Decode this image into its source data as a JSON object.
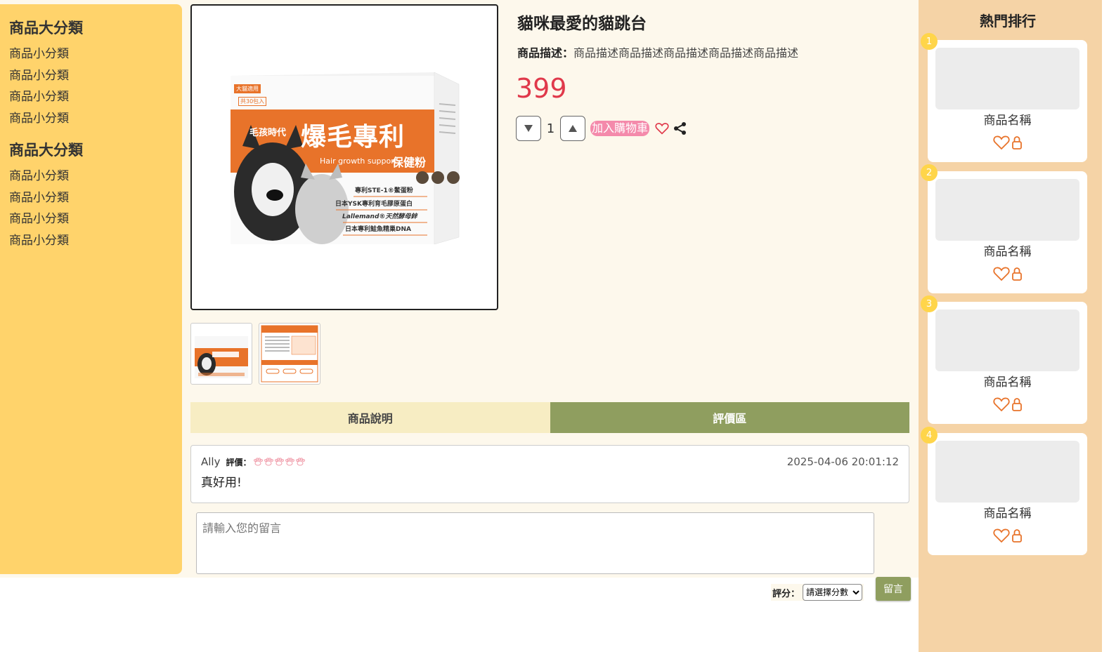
{
  "sidebar": {
    "groups": [
      {
        "title": "商品大分類",
        "items": [
          "商品小分類",
          "商品小分類",
          "商品小分類",
          "商品小分類"
        ]
      },
      {
        "title": "商品大分類",
        "items": [
          "商品小分類",
          "商品小分類",
          "商品小分類",
          "商品小分類"
        ]
      }
    ]
  },
  "product": {
    "title": "貓咪最愛的貓跳台",
    "desc_label": "商品描述：",
    "desc_text": "商品描述商品描述商品描述商品描述商品描述",
    "price": "399",
    "qty": "1",
    "add_to_cart": "加入購物車",
    "box_texts": {
      "badge1": "大貓適用",
      "badge2": "共30包入",
      "brand": "毛孩時代",
      "name": "爆毛專利",
      "sub_en": "Hair growth support",
      "sub_zh": "保健粉",
      "feature1": "專利STE-1®鱉蛋粉",
      "feature2": "日本YSK專利育毛膠原蛋白",
      "feature3": "Lallemand®天然酵母鋅",
      "feature4": "日本專利鮭魚精巢DNA"
    }
  },
  "tabs": {
    "description": "商品說明",
    "reviews": "評價區"
  },
  "comment": {
    "user": "Ally",
    "rating_label": "評價：",
    "rating": 5,
    "time": "2025-04-06 20:01:12",
    "body": "真好用!"
  },
  "message_form": {
    "placeholder": "請輸入您的留言",
    "score_label": "評分：",
    "score_select": "請選擇分數",
    "submit": "留言"
  },
  "ranking": {
    "title": "熱門排行",
    "items": [
      {
        "rank": "1",
        "name": "商品名稱"
      },
      {
        "rank": "2",
        "name": "商品名稱"
      },
      {
        "rank": "3",
        "name": "商品名稱"
      },
      {
        "rank": "4",
        "name": "商品名稱"
      }
    ]
  },
  "colors": {
    "sidebar_bg": "#ffd36b",
    "price": "#e0394b",
    "cart_button": "#f48aab",
    "tab_active": "#8f9e5f",
    "tab_inactive": "#f7edc3",
    "ranking_bg": "#f5d3a6",
    "rank_badge": "#ffd54a",
    "icon_accent": "#e8732a"
  },
  "icons": {
    "heart": "heart-icon",
    "share": "share-icon",
    "lock": "lock-icon",
    "paw": "paw-icon"
  }
}
